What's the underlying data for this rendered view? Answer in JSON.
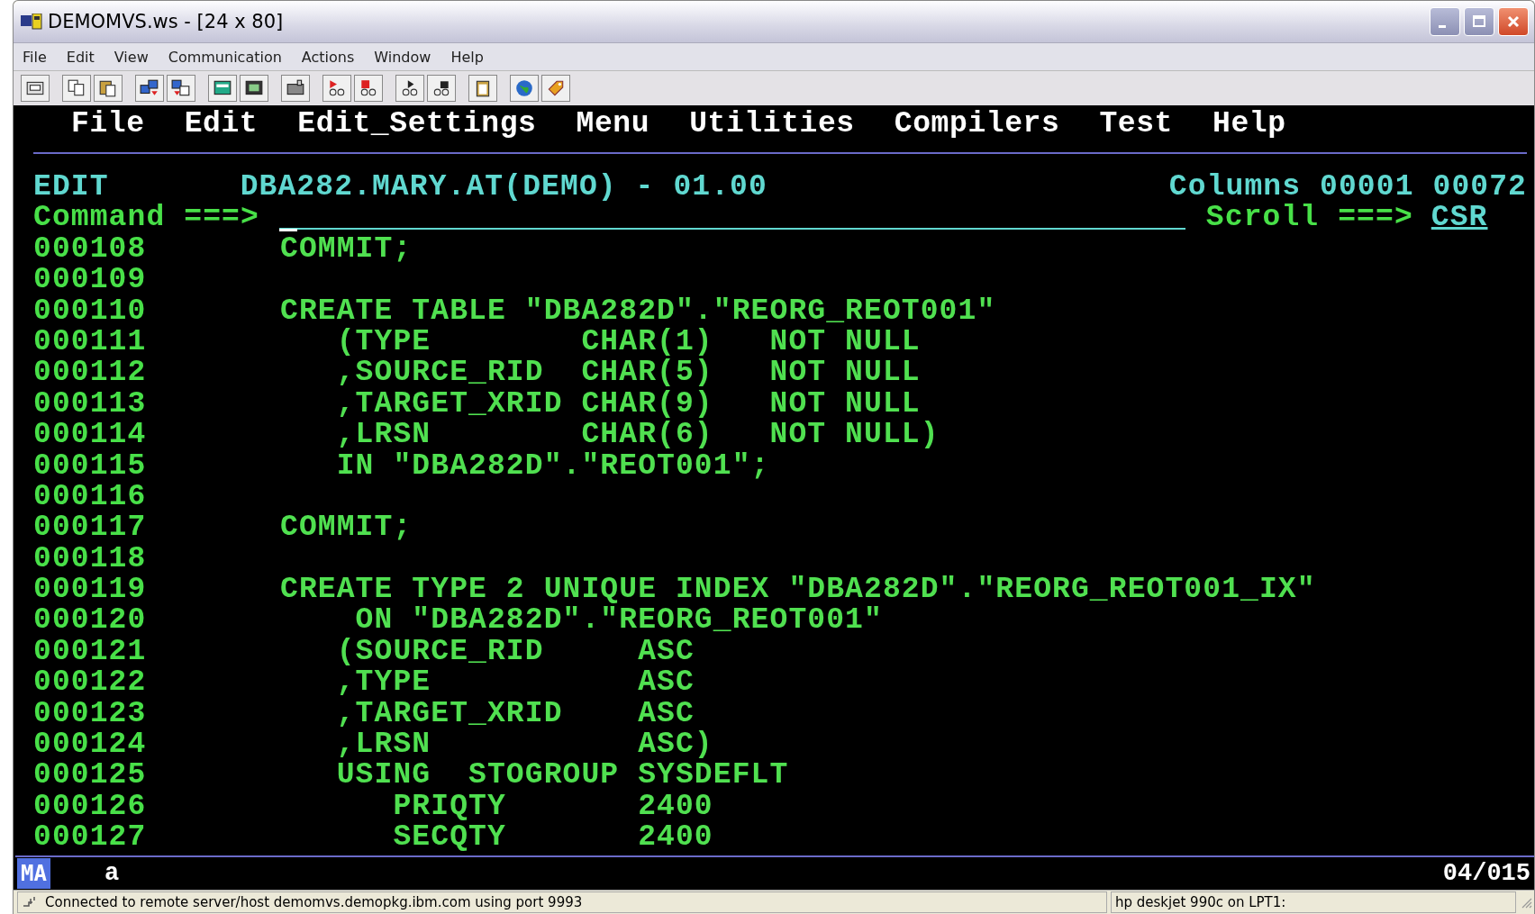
{
  "window": {
    "title": "DEMOMVS.ws - [24 x 80]"
  },
  "menu_bar": [
    "File",
    "Edit",
    "View",
    "Communication",
    "Actions",
    "Window",
    "Help"
  ],
  "terminal": {
    "menu": [
      "File",
      "Edit",
      "Edit_Settings",
      "Menu",
      "Utilities",
      "Compilers",
      "Test",
      "Help"
    ],
    "mode": "EDIT",
    "dataset": "DBA282.MARY.AT(DEMO) - 01.00",
    "columns": "Columns 00001 00072",
    "command_label": "Command ===>",
    "scroll_label": "Scroll ===>",
    "scroll_value": "CSR",
    "lines": [
      {
        "number": "000108",
        "text": "COMMIT;"
      },
      {
        "number": "000109"
      },
      {
        "number": "000110",
        "text": "CREATE TABLE \"DBA282D\".\"REORG_REOT001\""
      },
      {
        "number": "000111",
        "text": "   (TYPE        CHAR(1)   NOT NULL"
      },
      {
        "number": "000112",
        "text": "   ,SOURCE_RID  CHAR(5)   NOT NULL"
      },
      {
        "number": "000113",
        "text": "   ,TARGET_XRID CHAR(9)   NOT NULL"
      },
      {
        "number": "000114",
        "text": "   ,LRSN        CHAR(6)   NOT NULL)"
      },
      {
        "number": "000115",
        "text": "   IN \"DBA282D\".\"REOT001\";"
      },
      {
        "number": "000116"
      },
      {
        "number": "000117",
        "text": "COMMIT;"
      },
      {
        "number": "000118"
      },
      {
        "number": "000119",
        "text": "CREATE TYPE 2 UNIQUE INDEX \"DBA282D\".\"REORG_REOT001_IX\""
      },
      {
        "number": "000120",
        "text": "    ON \"DBA282D\".\"REORG_REOT001\""
      },
      {
        "number": "000121",
        "text": "   (SOURCE_RID     ASC"
      },
      {
        "number": "000122",
        "text": "   ,TYPE           ASC"
      },
      {
        "number": "000123",
        "text": "   ,TARGET_XRID    ASC"
      },
      {
        "number": "000124",
        "text": "   ,LRSN           ASC)"
      },
      {
        "number": "000125",
        "text": "   USING  STOGROUP SYSDEFLT"
      },
      {
        "number": "000126",
        "text": "      PRIQTY       2400"
      },
      {
        "number": "000127",
        "text": "      SECQTY       2400"
      }
    ],
    "oia": {
      "indicator": "MA",
      "input": "a",
      "cursor": "04/015"
    }
  },
  "status_bar": {
    "message": "Connected to remote server/host demomvs.demopkg.ibm.com using port 9993",
    "printer": "hp deskjet 990c on LPT1:"
  }
}
